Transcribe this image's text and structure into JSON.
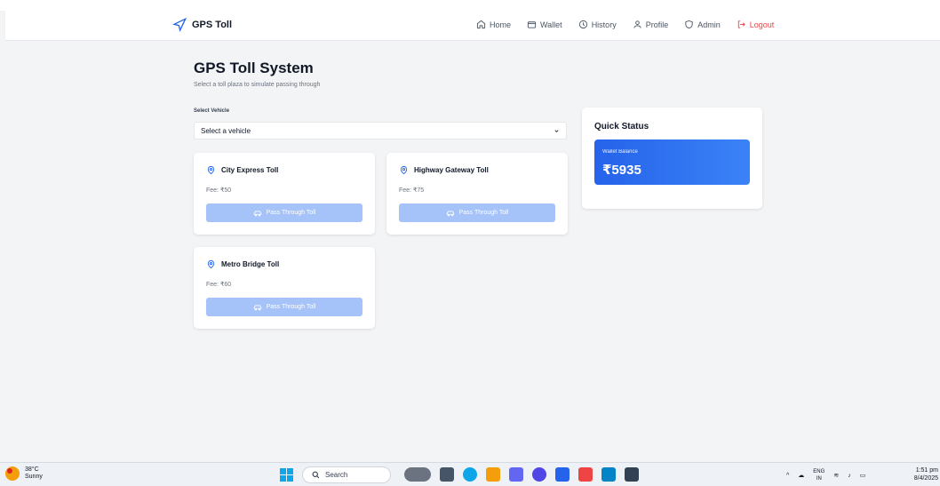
{
  "navbar": {
    "brand": "GPS Toll",
    "items": [
      {
        "label": "Home",
        "icon": "home-icon"
      },
      {
        "label": "Wallet",
        "icon": "wallet-icon"
      },
      {
        "label": "History",
        "icon": "history-icon"
      },
      {
        "label": "Profile",
        "icon": "user-icon"
      },
      {
        "label": "Admin",
        "icon": "shield-icon"
      },
      {
        "label": "Logout",
        "icon": "logout-icon"
      }
    ]
  },
  "page": {
    "title": "GPS Toll System",
    "subtitle": "Select a toll plaza to simulate passing through",
    "vehicle_label": "Select Vehicle",
    "vehicle_selected": "Select a vehicle"
  },
  "tolls": [
    {
      "name": "City Express Toll",
      "fee": "Fee: ₹50",
      "button": "Pass Through Toll"
    },
    {
      "name": "Highway Gateway Toll",
      "fee": "Fee: ₹75",
      "button": "Pass Through Toll"
    },
    {
      "name": "Metro Bridge Toll",
      "fee": "Fee: ₹60",
      "button": "Pass Through Toll"
    }
  ],
  "status": {
    "title": "Quick Status",
    "wallet_label": "Wallet Balance",
    "wallet_amount": "₹5935"
  },
  "taskbar": {
    "temp": "38°C",
    "condition": "Sunny",
    "search": "Search",
    "lang_top": "ENG",
    "lang_bottom": "IN",
    "time": "1:51 pm",
    "date": "8/4/2025"
  },
  "colors": {
    "accent": "#2563eb",
    "button_disabled": "#a5c3f9",
    "logout": "#ef4444"
  }
}
